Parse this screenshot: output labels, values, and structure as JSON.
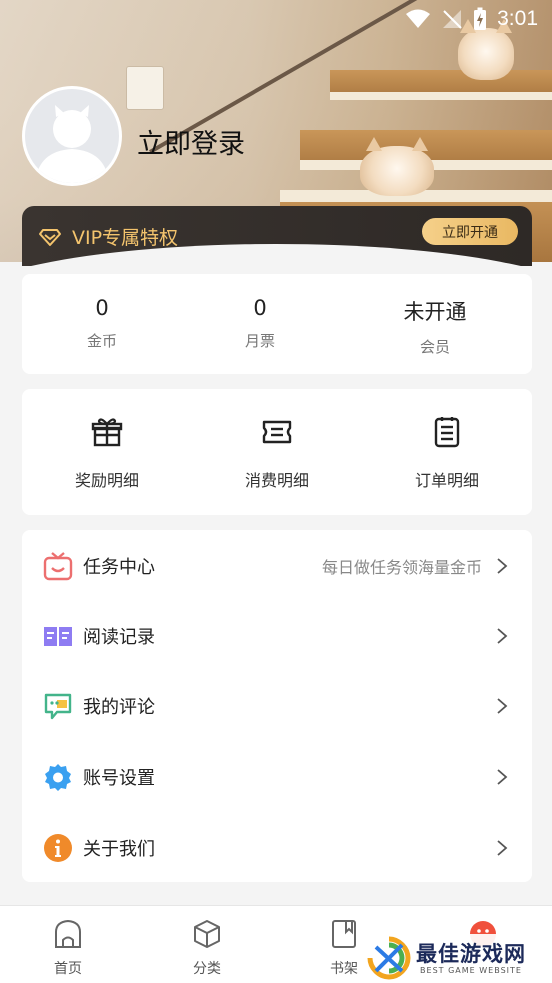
{
  "status_bar": {
    "time": "3:01"
  },
  "profile": {
    "login_text": "立即登录"
  },
  "vip": {
    "label": "VIP专属特权",
    "button": "立即开通",
    "accent": "#f4c46d"
  },
  "stats": [
    {
      "value": "0",
      "label": "金币"
    },
    {
      "value": "0",
      "label": "月票"
    },
    {
      "value": "未开通",
      "label": "会员"
    }
  ],
  "records": [
    {
      "icon": "gift-icon",
      "label": "奖励明细"
    },
    {
      "icon": "ticket-icon",
      "label": "消费明细"
    },
    {
      "icon": "order-list-icon",
      "label": "订单明细"
    }
  ],
  "menu": [
    {
      "icon": "task-box-icon",
      "label": "任务中心",
      "sub": "每日做任务领海量金币",
      "color": "#ec6f6f"
    },
    {
      "icon": "book-open-icon",
      "label": "阅读记录",
      "sub": "",
      "color": "#8e7cf2"
    },
    {
      "icon": "comment-icon",
      "label": "我的评论",
      "sub": "",
      "color": "#43b48a"
    },
    {
      "icon": "gear-icon",
      "label": "账号设置",
      "sub": "",
      "color": "#3aa0f0"
    },
    {
      "icon": "info-icon",
      "label": "关于我们",
      "sub": "",
      "color": "#f08a2a"
    }
  ],
  "bottom_nav": [
    {
      "icon": "home-icon",
      "label": "首页"
    },
    {
      "icon": "category-cube-icon",
      "label": "分类"
    },
    {
      "icon": "bookshelf-icon",
      "label": "书架"
    },
    {
      "icon": "profile-face-icon",
      "label": ""
    }
  ],
  "watermark": {
    "title": "最佳游戏网",
    "subtitle": "BEST GAME WEBSITE"
  }
}
